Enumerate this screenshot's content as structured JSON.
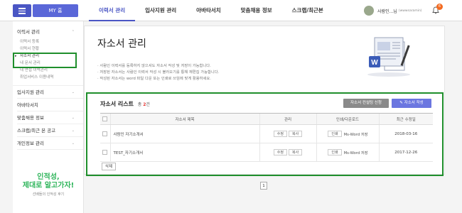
{
  "header": {
    "my_home": "MY 홈",
    "nav": [
      "이력서 관리",
      "입사지원 관리",
      "아바타서치",
      "맞춤채용 정보",
      "스크랩/최근본"
    ],
    "user_name": "사람인...님",
    "user_sub": "(wwwsaramin)",
    "notification_count": "6"
  },
  "sidebar": {
    "resume_mgmt": "이력서 관리",
    "resume_sub": [
      "이력서 등록",
      "이력서 현황",
      "자소서 관리",
      "내 문서 관리",
      "내 면접 이력관리",
      "취업서비스 이용내역"
    ],
    "apply_mgmt": "입사지원 관리",
    "avatar_search": "아바타서치",
    "custom_jobs": "맞춤채용 정보",
    "scrap": "스크랩/최근 본 공고",
    "privacy": "개인정보 관리",
    "ad_line1": "인적성,",
    "ad_line2": "제대로 알고가자!",
    "ad_line3": "선배들의 인적성 후기"
  },
  "main": {
    "title": "자소서 관리",
    "notes": [
      "· 사람인 이력서를 등록하지 않으셔도 자소서 작성 및 저장이 가능합니다.",
      "· 저장된 자소서는 사람인 이력서 작성 시 불러오기를 통해 재편집 가능합니다.",
      "· 작성된 자소서는 word 파일 다운 또는 인쇄로 쓰임에 맞게 활용하세요."
    ],
    "list_title": "자소서 리스트",
    "count_prefix": "총",
    "count_value": "2",
    "count_suffix": "건",
    "consult_btn": "자소서 컨설팅 신청",
    "write_btn": "자소서 작성",
    "columns": [
      "자소서 제목",
      "관리",
      "인쇄/다운로드",
      "최근 수정일"
    ],
    "rows": [
      {
        "title": "사람인 자기소개서",
        "edit": "수정",
        "copy": "복사",
        "print": "인쇄",
        "download": "Ms-Word 저장",
        "date": "2018-03-16"
      },
      {
        "title": "TEST_자기소개서",
        "edit": "수정",
        "copy": "복사",
        "print": "인쇄",
        "download": "Ms-Word 저장",
        "date": "2017-12-26"
      }
    ],
    "delete_btn": "삭제",
    "page": "1"
  }
}
